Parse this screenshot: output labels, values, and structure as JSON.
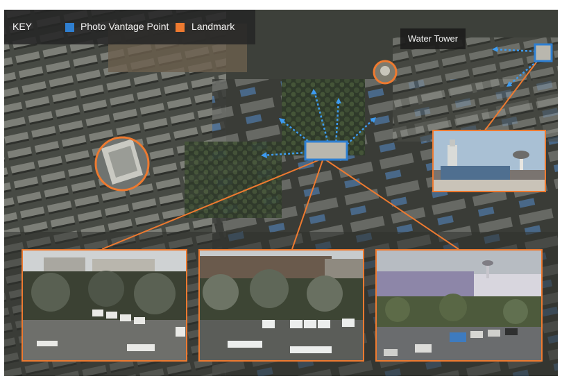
{
  "key": {
    "title": "KEY",
    "vantage_label": "Photo Vantage Point",
    "landmark_label": "Landmark"
  },
  "labels": {
    "water_tower": "Water Tower"
  },
  "colors": {
    "vantage": "#2f7fd0",
    "landmark": "#ee7a30",
    "arrow": "#3d9bf0"
  }
}
